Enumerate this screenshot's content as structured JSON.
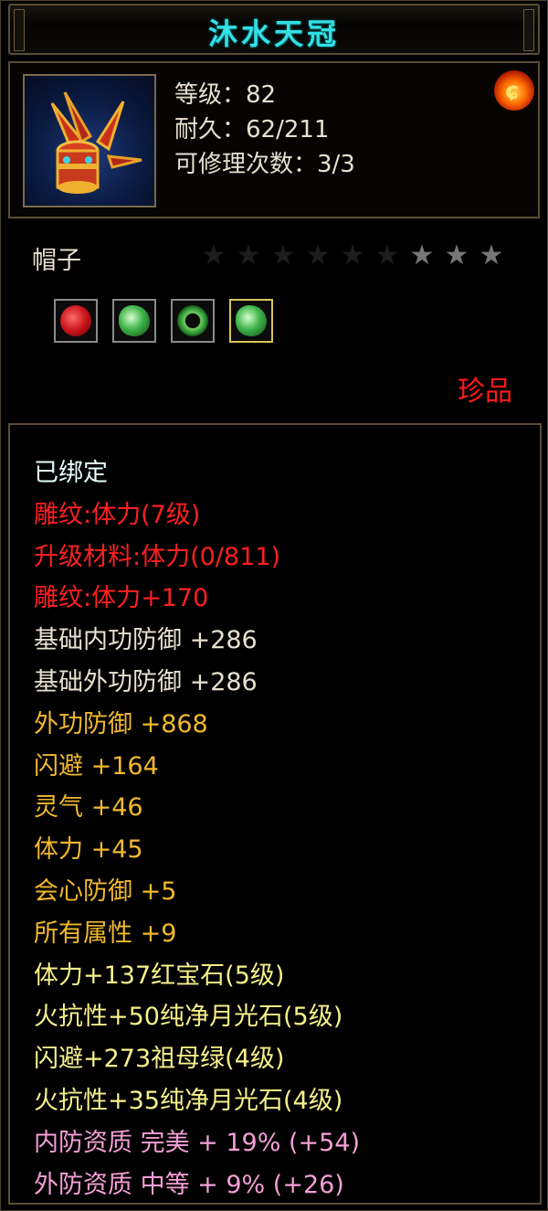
{
  "title": "沐水天冠",
  "header": {
    "level": "等级：82",
    "durability": "耐久：62/211",
    "repair_count": "可修理次数：3/3",
    "corner_icon": "fire-orb-icon"
  },
  "item_type": "帽子",
  "stars": {
    "total": 9,
    "filled": 3
  },
  "gems": [
    "ruby-icon",
    "jade-icon",
    "jade-ring-icon",
    "jade-icon"
  ],
  "rarity": "珍品",
  "attributes": [
    {
      "text": "已绑定",
      "color": "#e6ffff"
    },
    {
      "text": "雕纹:体力(7级)",
      "color": "#ff2020"
    },
    {
      "text": "升级材料:体力(0/811)",
      "color": "#ff2020"
    },
    {
      "text": "雕纹:体力+170",
      "color": "#ff2020"
    },
    {
      "text": "基础内功防御  +286",
      "color": "#e8e0cf"
    },
    {
      "text": "基础外功防御  +286",
      "color": "#e8e0cf"
    },
    {
      "text": "外功防御  +868",
      "color": "#f1b82e"
    },
    {
      "text": "闪避  +164",
      "color": "#f1b82e"
    },
    {
      "text": "灵气  +46",
      "color": "#f1b82e"
    },
    {
      "text": "体力  +45",
      "color": "#f1b82e"
    },
    {
      "text": "会心防御  +5",
      "color": "#f1b82e"
    },
    {
      "text": "所有属性  +9",
      "color": "#f1b82e"
    },
    {
      "text": "体力+137红宝石(5级)",
      "color": "#f6f08a"
    },
    {
      "text": "火抗性+50纯净月光石(5级)",
      "color": "#f6f08a"
    },
    {
      "text": "闪避+273祖母绿(4级)",
      "color": "#f6f08a"
    },
    {
      "text": "火抗性+35纯净月光石(4级)",
      "color": "#f6f08a"
    },
    {
      "text": "内防资质  完美  + 19% (+54)",
      "color": "#f59fd6"
    },
    {
      "text": "外防资质  中等  + 9% (+26)",
      "color": "#f59fd6"
    }
  ]
}
